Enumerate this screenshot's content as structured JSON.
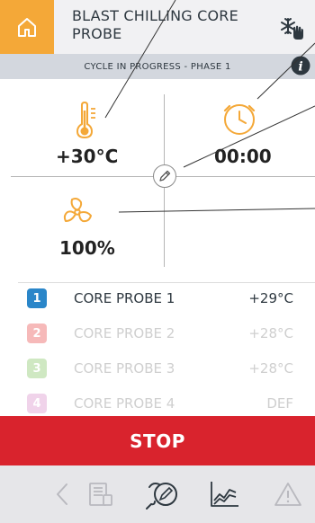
{
  "header": {
    "title": "BLAST CHILLING CORE PROBE",
    "home_icon": "home-icon",
    "mode_icon": "snowflake-hand-icon"
  },
  "status": {
    "text": "CYCLE IN PROGRESS - PHASE 1",
    "info_icon": "info-icon"
  },
  "cells": {
    "temperature": {
      "icon": "thermometer-icon",
      "value": "+30°C"
    },
    "time": {
      "icon": "clock-icon",
      "value": "00:00"
    },
    "fan": {
      "icon": "fan-icon",
      "value": "100%"
    },
    "edit_icon": "pencil-icon"
  },
  "probes": [
    {
      "number": "1",
      "name": "CORE PROBE 1",
      "value": "+29°C",
      "color": "#2a86c9",
      "active": true
    },
    {
      "number": "2",
      "name": "CORE PROBE 2",
      "value": "+28°C",
      "color": "#f6b9b9",
      "active": false
    },
    {
      "number": "3",
      "name": "CORE PROBE 3",
      "value": "+28°C",
      "color": "#cfe8c2",
      "active": false
    },
    {
      "number": "4",
      "name": "CORE PROBE 4",
      "value": "DEF",
      "color": "#f0d3ea",
      "active": false
    }
  ],
  "stop": {
    "label": "STOP"
  },
  "nav": {
    "items": [
      "back-icon",
      "recipe-book-icon",
      "probe-edit-icon",
      "chart-icon",
      "warning-icon"
    ]
  },
  "colors": {
    "accent": "#f4a838",
    "stop": "#d9232d",
    "status_bar": "#d3d7de"
  }
}
